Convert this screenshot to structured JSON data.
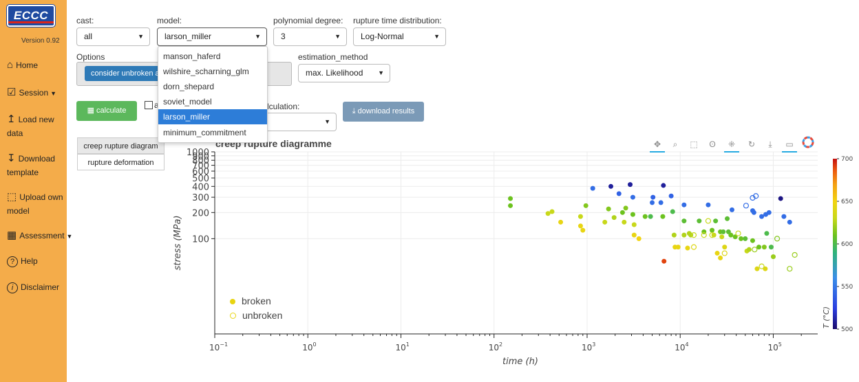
{
  "sidebar": {
    "logo": "ECCC",
    "version": "Version 0.92",
    "items": [
      {
        "label": "Home",
        "icon": "home-icon",
        "glyph": "⌂"
      },
      {
        "label": "Session",
        "icon": "session-icon",
        "glyph": "☑",
        "caret": true
      },
      {
        "label": "Load new",
        "label2": "data",
        "icon": "upload-icon",
        "glyph": "↥"
      },
      {
        "label": "Download",
        "label2": "template",
        "icon": "download-icon",
        "glyph": "↧"
      },
      {
        "label": "Upload own",
        "label2": "model",
        "icon": "upload-model-icon",
        "glyph": "⬚"
      },
      {
        "label": "Assessment",
        "icon": "calculator-icon",
        "glyph": "▦",
        "caret": true
      },
      {
        "label": "Help",
        "icon": "help-icon",
        "glyph": "?"
      },
      {
        "label": "Disclaimer",
        "icon": "info-icon",
        "glyph": "i"
      }
    ]
  },
  "controls": {
    "cast": {
      "label": "cast:",
      "value": "all"
    },
    "model": {
      "label": "model:",
      "value": "larson_miller",
      "options": [
        "manson_haferd",
        "wilshire_scharning_glm",
        "dorn_shepard",
        "soviet_model",
        "larson_miller",
        "minimum_commitment"
      ],
      "selected_index": 4
    },
    "polynomial": {
      "label": "polynomial degree:",
      "value": "3"
    },
    "rupture_dist": {
      "label": "rupture time distribution:",
      "value": "Log-Normal"
    },
    "options_label": "Options",
    "options_chip": "consider unbroken a",
    "estimation": {
      "label": "estimation_method",
      "value": "max. Likelihood"
    },
    "calculate": "calculate",
    "checkbox_tail": "a",
    "calc_label": "lculation:",
    "download_results": "download results"
  },
  "tabs": [
    "creep rupture diagram",
    "rupture deformation"
  ],
  "plot": {
    "title": "creep rupture diagramme",
    "tools": [
      "pan-tool-icon",
      "zoom-tool-icon",
      "box-select-icon",
      "lasso-icon",
      "hover-tool-icon",
      "reset-icon",
      "save-icon",
      "comment-icon",
      "bokeh-logo-icon"
    ]
  },
  "chart_data": {
    "type": "scatter",
    "title": "creep rupture diagramme",
    "xlabel": "time (h)",
    "ylabel": "stress (MPa)",
    "xscale": "log",
    "yscale": "log",
    "xlim": [
      0.1,
      300000
    ],
    "ylim": [
      8,
      1000
    ],
    "x_ticks": [
      "10^-1",
      "10^0",
      "10^1",
      "10^2",
      "10^3",
      "10^4",
      "10^5"
    ],
    "y_ticks": [
      100,
      200,
      300,
      400,
      500,
      600,
      700,
      800,
      900,
      1000
    ],
    "grid": true,
    "legend_position": "bottom-left",
    "colorbar": {
      "label": "T (°C)",
      "min": 500,
      "max": 700,
      "ticks": [
        500,
        550,
        600,
        650,
        700
      ]
    },
    "series": [
      {
        "name": "broken",
        "filled": true,
        "points": [
          [
            150,
            290,
            610
          ],
          [
            150,
            240,
            610
          ],
          [
            380,
            195,
            630
          ],
          [
            420,
            205,
            630
          ],
          [
            520,
            155,
            645
          ],
          [
            850,
            180,
            630
          ],
          [
            850,
            140,
            645
          ],
          [
            900,
            125,
            645
          ],
          [
            970,
            240,
            615
          ],
          [
            1150,
            380,
            545
          ],
          [
            1550,
            155,
            630
          ],
          [
            1700,
            220,
            615
          ],
          [
            1800,
            400,
            510
          ],
          [
            1950,
            175,
            625
          ],
          [
            2200,
            330,
            540
          ],
          [
            2400,
            200,
            610
          ],
          [
            2500,
            155,
            630
          ],
          [
            2600,
            225,
            615
          ],
          [
            2900,
            420,
            510
          ],
          [
            3100,
            300,
            545
          ],
          [
            3100,
            190,
            610
          ],
          [
            3200,
            145,
            630
          ],
          [
            3200,
            110,
            645
          ],
          [
            3600,
            100,
            650
          ],
          [
            4200,
            180,
            610
          ],
          [
            4800,
            180,
            600
          ],
          [
            5000,
            260,
            545
          ],
          [
            5100,
            300,
            540
          ],
          [
            6200,
            260,
            545
          ],
          [
            6500,
            180,
            610
          ],
          [
            6600,
            410,
            510
          ],
          [
            6700,
            55,
            690
          ],
          [
            8000,
            310,
            540
          ],
          [
            8300,
            205,
            600
          ],
          [
            8600,
            110,
            625
          ],
          [
            8800,
            80,
            645
          ],
          [
            9500,
            80,
            645
          ],
          [
            11000,
            245,
            545
          ],
          [
            11000,
            160,
            605
          ],
          [
            11000,
            110,
            625
          ],
          [
            12000,
            78,
            645
          ],
          [
            12500,
            115,
            625
          ],
          [
            13000,
            110,
            625
          ],
          [
            16000,
            160,
            605
          ],
          [
            20000,
            245,
            545
          ],
          [
            22000,
            125,
            610
          ],
          [
            23000,
            110,
            630
          ],
          [
            24000,
            160,
            605
          ],
          [
            27000,
            120,
            610
          ],
          [
            28000,
            105,
            630
          ],
          [
            29000,
            120,
            605
          ],
          [
            30000,
            80,
            640
          ],
          [
            32000,
            170,
            605
          ],
          [
            33000,
            120,
            605
          ],
          [
            35000,
            110,
            610
          ],
          [
            36000,
            215,
            545
          ],
          [
            39000,
            105,
            610
          ],
          [
            45000,
            100,
            610
          ],
          [
            50000,
            100,
            605
          ],
          [
            52000,
            72,
            630
          ],
          [
            55000,
            75,
            625
          ],
          [
            60000,
            95,
            610
          ],
          [
            60000,
            210,
            545
          ],
          [
            62000,
            200,
            545
          ],
          [
            70000,
            80,
            610
          ],
          [
            75000,
            180,
            545
          ],
          [
            80000,
            80,
            615
          ],
          [
            83000,
            190,
            545
          ],
          [
            85000,
            115,
            600
          ],
          [
            90000,
            200,
            545
          ],
          [
            95000,
            80,
            600
          ],
          [
            100000,
            62,
            620
          ],
          [
            120000,
            290,
            505
          ],
          [
            130000,
            180,
            545
          ],
          [
            150000,
            155,
            545
          ],
          [
            25000,
            68,
            645
          ],
          [
            67000,
            45,
            640
          ],
          [
            82000,
            45,
            640
          ],
          [
            27000,
            60,
            645
          ],
          [
            18000,
            120,
            610
          ]
        ]
      },
      {
        "name": "unbroken",
        "filled": false,
        "points": [
          [
            14000,
            110,
            630
          ],
          [
            18000,
            110,
            630
          ],
          [
            20000,
            160,
            630
          ],
          [
            22000,
            110,
            630
          ],
          [
            42000,
            115,
            630
          ],
          [
            30000,
            68,
            640
          ],
          [
            51000,
            240,
            545
          ],
          [
            60000,
            295,
            545
          ],
          [
            65000,
            310,
            545
          ],
          [
            63000,
            75,
            620
          ],
          [
            75000,
            48,
            630
          ],
          [
            110000,
            100,
            615
          ],
          [
            150000,
            45,
            620
          ],
          [
            170000,
            65,
            620
          ],
          [
            14000,
            80,
            640
          ]
        ]
      }
    ]
  }
}
